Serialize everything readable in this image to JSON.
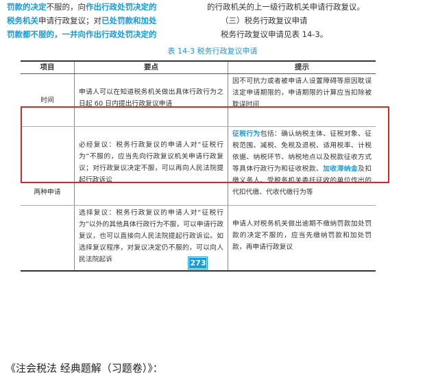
{
  "top_text": {
    "left_lines": [
      [
        {
          "t": "罚款的决定",
          "hl": true
        },
        {
          "t": "不服的，向",
          "hl": false
        },
        {
          "t": "作出行政处罚决定的",
          "hl": true
        }
      ],
      [
        {
          "t": "税务机关",
          "hl": true
        },
        {
          "t": "申请行政复议；对",
          "hl": false
        },
        {
          "t": "已处罚款和加处",
          "hl": true
        }
      ],
      [
        {
          "t": "罚款都不服的，一并向作出行政处罚决定的",
          "hl": true
        }
      ]
    ],
    "right_line1": "的行政机关的上一级行政机关申请行政复议。",
    "right_line2": "（三）税务行政复议申请",
    "right_line3": "税务行政复议申请见表 14-3。"
  },
  "table": {
    "caption": "表 14-3   税务行政复议申请",
    "headers": [
      "项目",
      "要点",
      "提示"
    ],
    "row_time": {
      "item": "时间",
      "points": "申请人可以在知道税务机关做出具体行政行为之日起 60 日内提出行政复议申请",
      "tip": "因不可抗力或者被申请人设置障碍等原因耽误法定申请期限的，申请期限的计算应当扣除被耽误时间"
    },
    "row_two": {
      "item": "两种申请",
      "points_a": "必经复议：税务行政复议的申请人对“征税行为”不服的，应当先向行政复议机关申请行政复议；对行政复议决定不服，可以再向人民法院提起行政诉讼",
      "tip_a_hl1": "征税行为",
      "tip_a_part1": "包括：确认纳税主体、征税对象、征税范围、减税、免税及退税、适用税率、计税依据、纳税环节、纳税地点以及税款征收方式等具体行政行为和征收税款、",
      "tip_a_hl2": "加收滞纳金",
      "tip_a_part2": "及扣缴义务人、受税务机关委托征收的单位作出的代扣代缴、代收代缴行为等",
      "points_b": "选择复议：税务行政复议的申请人对“征税行为”以外的其他具体行政行为不服，可以申请行政复议，也可以直接向人民法院提起行政诉讼。如选择复议程序，对复议决定仍不服的，可以向人民法院起诉",
      "tip_b": "申请人对税务机关做出逾期不缴纳罚款加处罚款的决定不服的，应当先缴纳罚款和加处罚款，再申请行政复议"
    }
  },
  "page_number": "273",
  "footer": "《注会税法 经典题解（习题卷）》：",
  "colors": {
    "accent": "#1a9ad6",
    "highlight_box": "#d62828"
  }
}
